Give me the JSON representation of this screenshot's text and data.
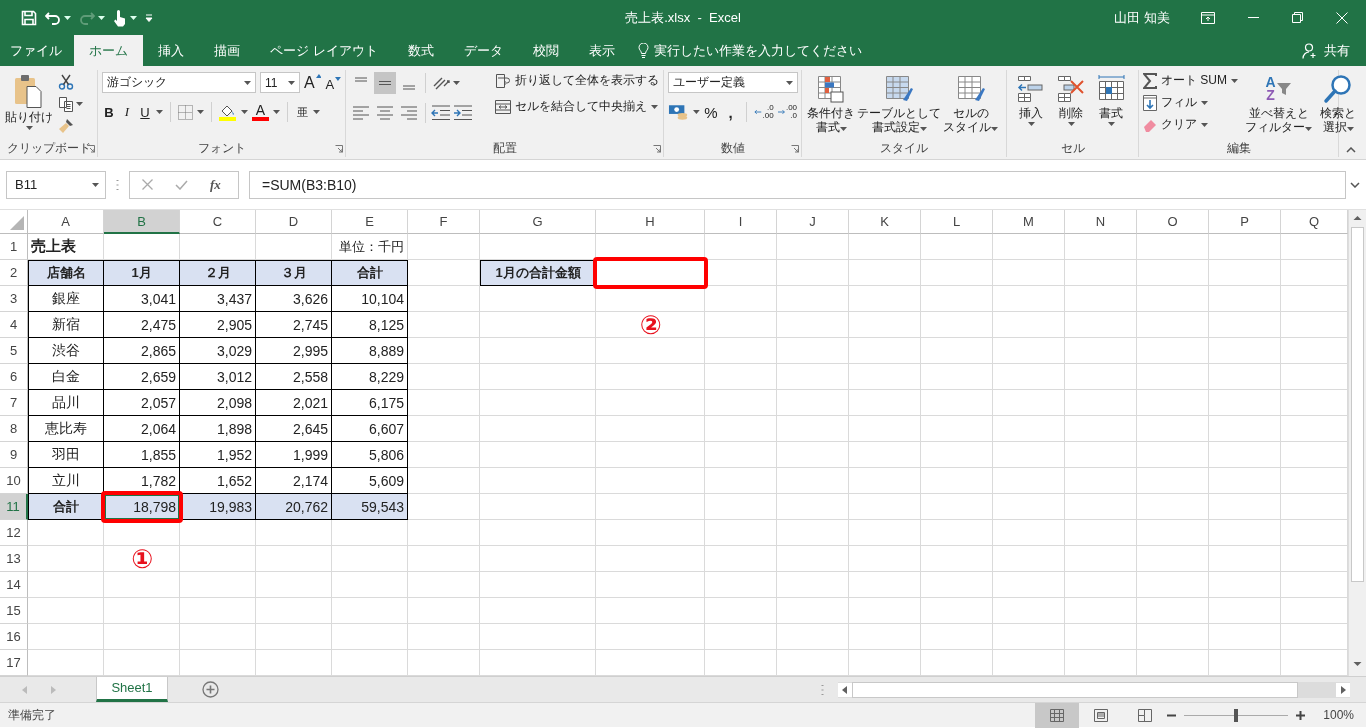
{
  "window": {
    "title": "売上表.xlsx  -  Excel",
    "user": "山田 知美"
  },
  "quick_access": {
    "undo_disabled": false,
    "redo_disabled": true
  },
  "ribbon_tabs": [
    {
      "label": "ファイル",
      "selected": false
    },
    {
      "label": "ホーム",
      "selected": true
    },
    {
      "label": "挿入",
      "selected": false
    },
    {
      "label": "描画",
      "selected": false
    },
    {
      "label": "ページ レイアウト",
      "selected": false
    },
    {
      "label": "数式",
      "selected": false
    },
    {
      "label": "データ",
      "selected": false
    },
    {
      "label": "校閲",
      "selected": false
    },
    {
      "label": "表示",
      "selected": false
    }
  ],
  "tell_me": {
    "placeholder": "実行したい作業を入力してください"
  },
  "share": "共有",
  "ribbon": {
    "clipboard": {
      "paste": "貼り付け",
      "label": "クリップボード"
    },
    "font": {
      "font_name": "游ゴシック",
      "font_size": "11",
      "grow": "A",
      "shrink": "A",
      "bold": "B",
      "italic": "I",
      "underline": "U",
      "font_color": "A",
      "phonetic": "亜",
      "label": "フォント"
    },
    "alignment": {
      "vertical": [
        {
          "selected": false
        },
        {
          "selected": true
        },
        {
          "selected": false
        }
      ],
      "wrap_text": "折り返して全体を表示する",
      "merge": "セルを結合して中央揃え",
      "label": "配置"
    },
    "number": {
      "format": "ユーザー定義",
      "percent": "%",
      "comma": ",",
      "decimals": [
        {
          "top": ".0",
          "bottom": ".00"
        },
        {
          "top": ".00",
          "bottom": ".0"
        }
      ],
      "label": "数値"
    },
    "styles": {
      "buttons": [
        {
          "lines": [
            "条件付き",
            "書式"
          ]
        },
        {
          "lines": [
            "テーブルとして",
            "書式設定"
          ]
        },
        {
          "lines": [
            "セルの",
            "スタイル"
          ]
        }
      ],
      "label": "スタイル"
    },
    "cells": {
      "buttons": [
        "挿入",
        "削除",
        "書式"
      ],
      "label": "セル"
    },
    "editing": {
      "autosum": "オート SUM",
      "fill": "フィル",
      "clear": "クリア",
      "sort_letters": [
        "A",
        "Z"
      ],
      "sort": [
        "並べ替えと",
        "フィルター"
      ],
      "find": [
        "検索と",
        "選択"
      ],
      "label": "編集"
    }
  },
  "formula_bar": {
    "name_box": "B11",
    "fx": "fx",
    "formula": "=SUM(B3:B10)"
  },
  "sheet": {
    "columns": [
      {
        "letter": "A",
        "selected": false
      },
      {
        "letter": "B",
        "selected": true
      },
      {
        "letter": "C",
        "selected": false
      },
      {
        "letter": "D",
        "selected": false
      },
      {
        "letter": "E",
        "selected": false
      },
      {
        "letter": "F",
        "selected": false
      },
      {
        "letter": "G",
        "selected": false
      },
      {
        "letter": "H",
        "selected": false
      },
      {
        "letter": "I",
        "selected": false
      },
      {
        "letter": "J",
        "selected": false
      },
      {
        "letter": "K",
        "selected": false
      },
      {
        "letter": "L",
        "selected": false
      },
      {
        "letter": "M",
        "selected": false
      },
      {
        "letter": "N",
        "selected": false
      },
      {
        "letter": "O",
        "selected": false
      },
      {
        "letter": "P",
        "selected": false
      },
      {
        "letter": "Q",
        "selected": false
      }
    ],
    "rows": [
      {
        "number": "1",
        "selected": false
      },
      {
        "number": "2",
        "selected": false
      },
      {
        "number": "3",
        "selected": false
      },
      {
        "number": "4",
        "selected": false
      },
      {
        "number": "5",
        "selected": false
      },
      {
        "number": "6",
        "selected": false
      },
      {
        "number": "7",
        "selected": false
      },
      {
        "number": "8",
        "selected": false
      },
      {
        "number": "9",
        "selected": false
      },
      {
        "number": "10",
        "selected": false
      },
      {
        "number": "11",
        "selected": true
      },
      {
        "number": "12",
        "selected": false
      },
      {
        "number": "13",
        "selected": false
      },
      {
        "number": "14",
        "selected": false
      },
      {
        "number": "15",
        "selected": false
      },
      {
        "number": "16",
        "selected": false
      },
      {
        "number": "17",
        "selected": false
      }
    ],
    "title": "売上表",
    "unit": "単位：千円",
    "table": {
      "headers": [
        "店舗名",
        "1月",
        "２月",
        "３月",
        "合計"
      ],
      "rows": [
        {
          "cells": [
            "銀座",
            "3,041",
            "3,437",
            "3,626",
            "10,104"
          ]
        },
        {
          "cells": [
            "新宿",
            "2,475",
            "2,905",
            "2,745",
            "8,125"
          ]
        },
        {
          "cells": [
            "渋谷",
            "2,865",
            "3,029",
            "2,995",
            "8,889"
          ]
        },
        {
          "cells": [
            "白金",
            "2,659",
            "3,012",
            "2,558",
            "8,229"
          ]
        },
        {
          "cells": [
            "品川",
            "2,057",
            "2,098",
            "2,021",
            "6,175"
          ]
        },
        {
          "cells": [
            "恵比寿",
            "2,064",
            "1,898",
            "2,645",
            "6,607"
          ]
        },
        {
          "cells": [
            "羽田",
            "1,855",
            "1,952",
            "1,999",
            "5,806"
          ]
        },
        {
          "cells": [
            "立川",
            "1,782",
            "1,652",
            "2,174",
            "5,609"
          ]
        }
      ],
      "total": [
        "合計",
        "18,798",
        "19,983",
        "20,762",
        "59,543"
      ]
    },
    "lookup": {
      "label": "1月の合計金額"
    },
    "callouts": [
      {
        "text": "①"
      },
      {
        "text": "②"
      }
    ]
  },
  "sheet_tabs": [
    {
      "label": "Sheet1",
      "selected": true
    }
  ],
  "status_bar": {
    "status": "準備完了",
    "views": [
      {
        "selected": true
      },
      {
        "selected": false
      },
      {
        "selected": false
      }
    ],
    "zoom": {
      "level": 0.5
    },
    "zoom_text": "100%"
  }
}
